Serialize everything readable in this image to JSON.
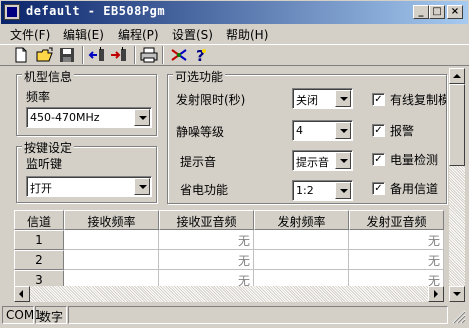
{
  "window": {
    "title": "default - EB508Pgm"
  },
  "title_buttons": {
    "minimize": "_",
    "maximize": "□",
    "close": "×"
  },
  "menu": [
    {
      "label": "文件(F)"
    },
    {
      "label": "编辑(E)"
    },
    {
      "label": "编程(P)"
    },
    {
      "label": "设置(S)"
    },
    {
      "label": "帮助(H)"
    }
  ],
  "toolbar": {
    "icons": [
      "new-file-icon",
      "open-folder-icon",
      "save-icon",
      "read-radio-icon",
      "write-radio-icon",
      "print-icon",
      "settings-icon",
      "help-icon"
    ]
  },
  "model_info": {
    "title": "机型信息",
    "freq_label": "频率",
    "freq_value": "450-470MHz"
  },
  "key_settings": {
    "title": "按键设定",
    "monitor_label": "监听键",
    "monitor_value": "打开"
  },
  "options": {
    "title": "可选功能",
    "tx_limit_label": "发射限时(秒)",
    "tx_limit_value": "关闭",
    "squelch_label": "静噪等级",
    "squelch_value": "4",
    "prompt_label": "提示音",
    "prompt_value": "提示音",
    "power_save_label": "省电功能",
    "power_save_value": "1:2",
    "checks": [
      {
        "label": "有线复制模",
        "checked": true
      },
      {
        "label": "报警",
        "checked": true
      },
      {
        "label": "电量检测",
        "checked": true
      },
      {
        "label": "备用信道",
        "checked": true
      }
    ],
    "check_mark": "✓"
  },
  "grid": {
    "headers": [
      "信道",
      "接收频率",
      "接收亚音频",
      "发射频率",
      "发射亚音频"
    ],
    "rows": [
      {
        "ch": "1",
        "rx_freq": "",
        "rx_tone": "无",
        "tx_freq": "",
        "tx_tone": "无"
      },
      {
        "ch": "2",
        "rx_freq": "",
        "rx_tone": "无",
        "tx_freq": "",
        "tx_tone": "无"
      },
      {
        "ch": "3",
        "rx_freq": "",
        "rx_tone": "无",
        "tx_freq": "",
        "tx_tone": "无"
      }
    ]
  },
  "statusbar": {
    "port": "COM1",
    "mode": "数字"
  }
}
